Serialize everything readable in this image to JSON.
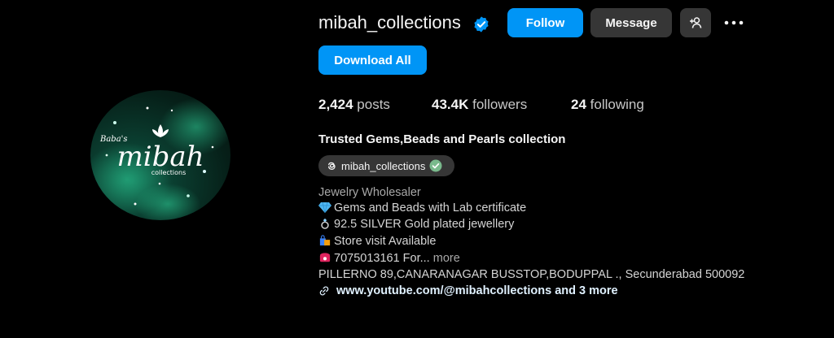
{
  "profile": {
    "username": "mibah_collections",
    "verified": true,
    "avatar_text": {
      "top": "Baba's",
      "main": "mibah",
      "sub": "collections"
    }
  },
  "actions": {
    "follow_label": "Follow",
    "message_label": "Message",
    "download_label": "Download All",
    "add_user_icon": "add-user-icon",
    "more_icon": "more-icon"
  },
  "stats": {
    "posts_count": "2,424",
    "posts_label": "posts",
    "followers_count": "43.4K",
    "followers_label": "followers",
    "following_count": "24",
    "following_label": "following"
  },
  "bio": {
    "name": "Trusted Gems,Beads and Pearls collection",
    "threads_handle": "mibah_collections",
    "category": "Jewelry Wholesaler",
    "line1": "Gems and Beads with Lab certificate",
    "line2": "92.5 SILVER Gold plated jewellery",
    "line3": "Store visit Available",
    "line4": "7075013161 For...",
    "more_label": "more",
    "address": "PILLERNO 89,CANARANAGAR BUSSTOP,BODUPPAL ., Secunderabad 500092",
    "link": "www.youtube.com/@mibahcollections and 3 more"
  },
  "colors": {
    "accent": "#0095f6",
    "button_secondary": "#363636",
    "background": "#000000"
  }
}
